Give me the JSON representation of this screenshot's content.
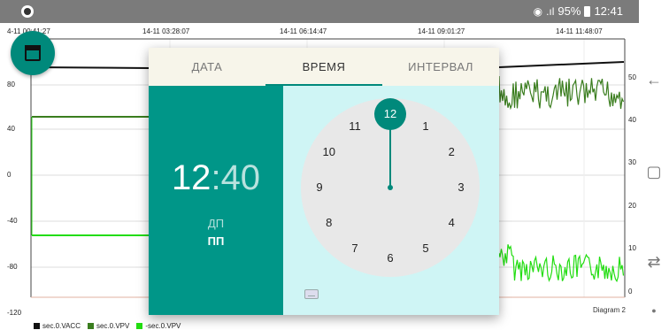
{
  "status_bar": {
    "battery": "95%",
    "time": "12:41"
  },
  "chart": {
    "x_ticks": [
      "4-11 00:41:27",
      "14-11 03:28:07",
      "14-11 06:14:47",
      "14-11 09:01:27",
      "14-11 11:48:07"
    ],
    "y_left_ticks": [
      "80",
      "40",
      "0",
      "-40",
      "-80",
      "-120"
    ],
    "y_right_ticks": [
      "50",
      "40",
      "30",
      "20",
      "10",
      "0"
    ],
    "diagram_label": "Diagram 2",
    "legend": [
      {
        "name": "sec.0.VACC",
        "color": "#111111"
      },
      {
        "name": "sec.0.VPV",
        "color": "#3a7d1e"
      },
      {
        "name": "-sec.0.VPV",
        "color": "#22dd11"
      }
    ]
  },
  "chart_data": {
    "type": "line",
    "x_ticks": [
      "4-11 00:41:27",
      "14-11 03:28:07",
      "14-11 06:14:47",
      "14-11 09:01:27",
      "14-11 11:48:07"
    ],
    "y_left_range": [
      -120,
      100
    ],
    "y_right_range": [
      0,
      55
    ],
    "series": [
      {
        "name": "sec.0.VACC",
        "color": "#111111"
      },
      {
        "name": "sec.0.VPV",
        "color": "#3a7d1e"
      },
      {
        "name": "-sec.0.VPV",
        "color": "#22dd11"
      }
    ],
    "legend_position": "bottom-left",
    "grid": true
  },
  "dialog": {
    "tabs": [
      {
        "label": "ДАТА"
      },
      {
        "label": "ВРЕМЯ"
      },
      {
        "label": "ИНТЕРВАЛ"
      }
    ],
    "active_tab": "ВРЕМЯ",
    "hour": "12",
    "separator": ":",
    "minute": "40",
    "am_label": "ДП",
    "pm_label": "ПП",
    "selected_period": "ПП",
    "selected_number": "12",
    "clock_numbers": [
      "12",
      "1",
      "2",
      "3",
      "4",
      "5",
      "6",
      "7",
      "8",
      "9",
      "10",
      "11"
    ],
    "accent_color": "#009688"
  },
  "fab": {
    "icon": "calendar-icon"
  },
  "nav": {
    "back": "back-icon",
    "recents": "recents-icon",
    "switch": "switch-icon",
    "home": "home-dot-icon"
  }
}
